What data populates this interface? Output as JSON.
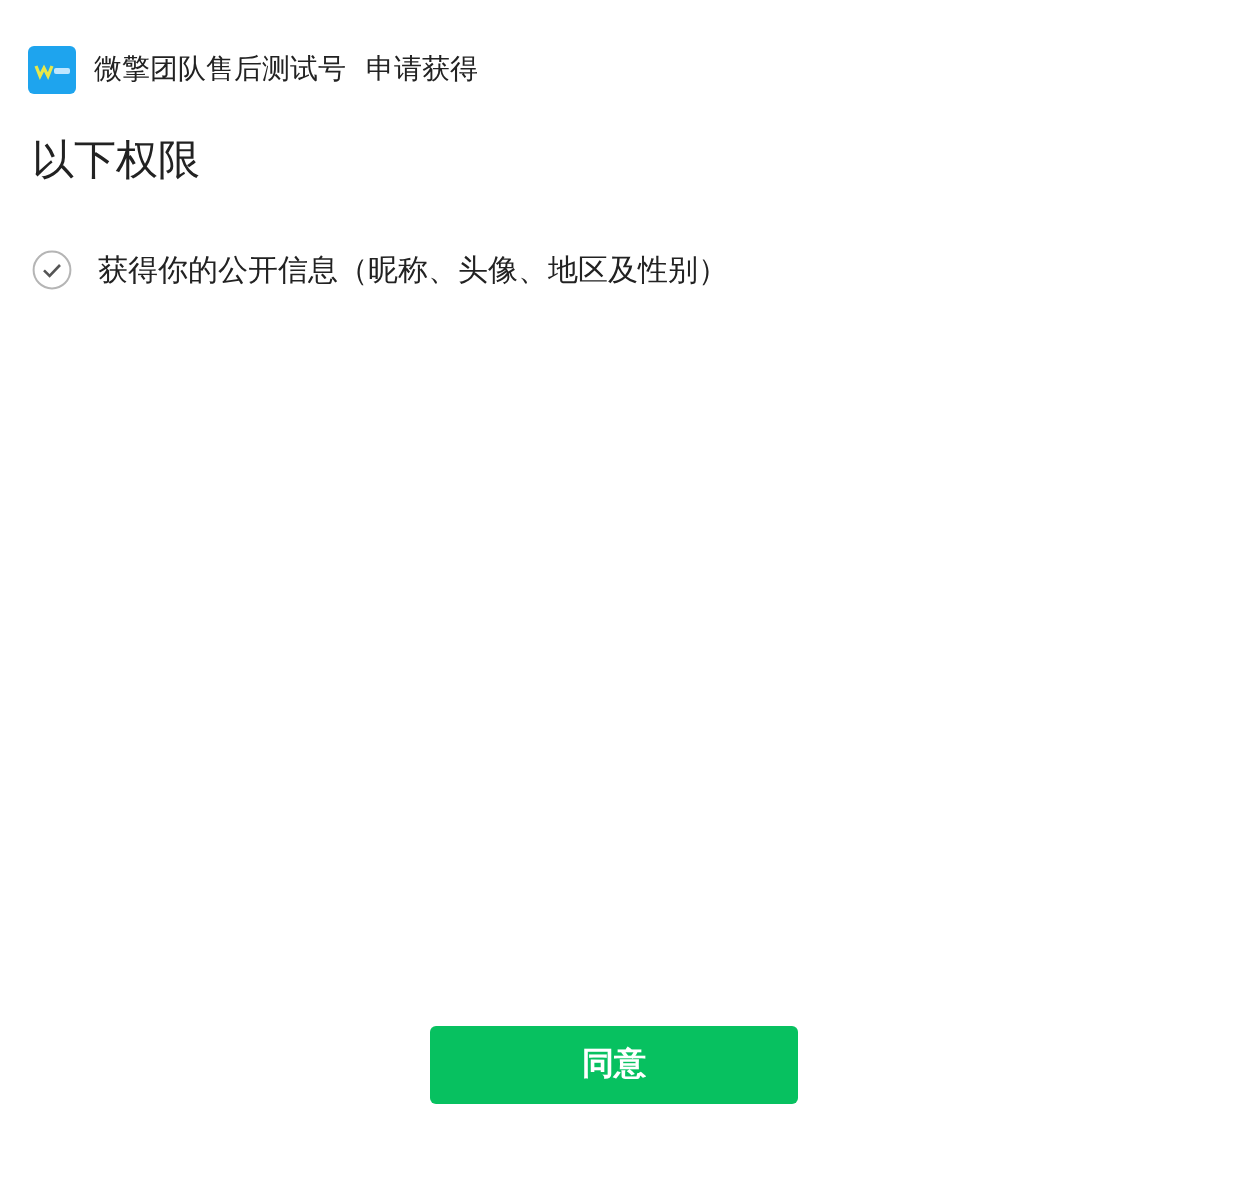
{
  "header": {
    "app_name": "微擎团队售后测试号",
    "action": "申请获得"
  },
  "title": "以下权限",
  "permissions": [
    {
      "label": "获得你的公开信息（昵称、头像、地区及性别）",
      "checked": true
    }
  ],
  "buttons": [
    {
      "label": "同意"
    }
  ]
}
